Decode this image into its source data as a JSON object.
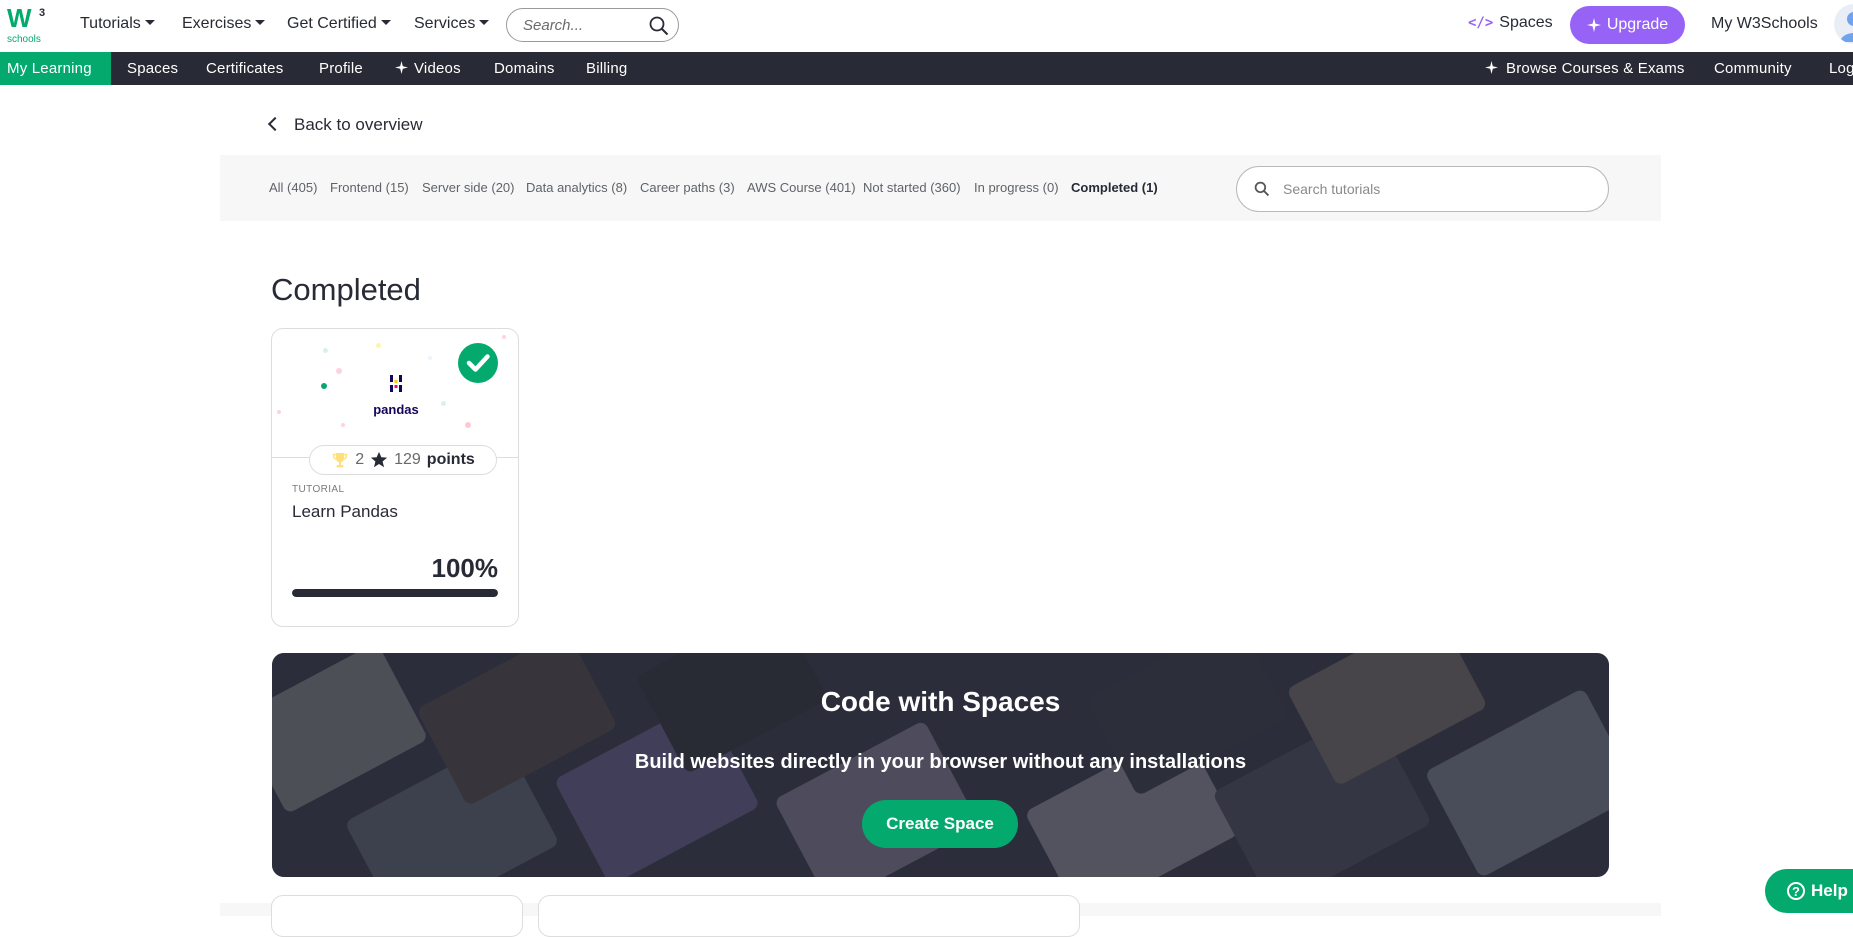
{
  "topnav": {
    "logo_text": "schools",
    "logo_sup": "3",
    "items": [
      {
        "label": "Tutorials"
      },
      {
        "label": "Exercises"
      },
      {
        "label": "Get Certified"
      },
      {
        "label": "Services"
      }
    ],
    "search_placeholder": "Search...",
    "spaces_label": "Spaces",
    "upgrade_label": "Upgrade",
    "my_w3schools_label": "My W3Schools"
  },
  "subnav": {
    "items": [
      {
        "label": "My Learning"
      },
      {
        "label": "Spaces"
      },
      {
        "label": "Certificates"
      },
      {
        "label": "Profile"
      },
      {
        "label": "Videos"
      },
      {
        "label": "Domains"
      },
      {
        "label": "Billing"
      }
    ],
    "browse_label": "Browse Courses & Exams",
    "community_label": "Community",
    "log_label": "Log"
  },
  "back_label": "Back to overview",
  "filters": [
    {
      "label": "All (405)"
    },
    {
      "label": "Frontend (15)"
    },
    {
      "label": "Server side (20)"
    },
    {
      "label": "Data analytics (8)"
    },
    {
      "label": "Career paths (3)"
    },
    {
      "label": "AWS Course (401)"
    },
    {
      "label": "Not started (360)"
    },
    {
      "label": "In progress (0)"
    },
    {
      "label": "Completed (1)"
    }
  ],
  "tutorial_search_placeholder": "Search tutorials",
  "section_heading": "Completed",
  "card": {
    "logo_text": "pandas",
    "trophies": "2",
    "points_value": "129",
    "points_label": "points",
    "type_label": "TUTORIAL",
    "title": "Learn Pandas",
    "percent_label": "100%",
    "progress_fraction": 1.0
  },
  "banner": {
    "title": "Code with Spaces",
    "subtitle": "Build websites directly in your browser without any installations",
    "button_label": "Create Space"
  },
  "help_label": "Help",
  "colors": {
    "accent_green": "#04aa6d",
    "upgrade_purple": "#9763f6",
    "dark_bar": "#282a35"
  }
}
